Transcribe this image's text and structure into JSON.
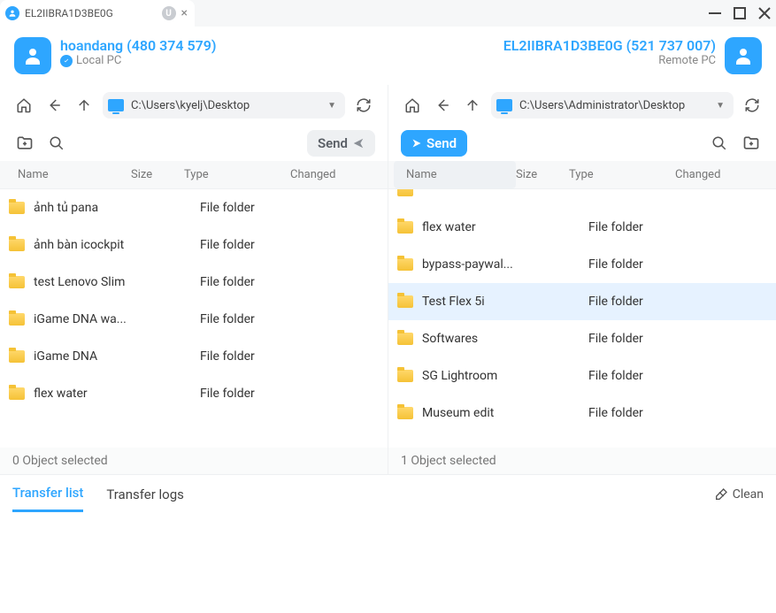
{
  "tab": {
    "title": "EL2IIBRA1D3BE0G",
    "badge": "U"
  },
  "local": {
    "name": "hoandang (480 374 579)",
    "subtitle": "Local PC",
    "path": "C:\\Users\\kyelj\\Desktop",
    "send_label": "Send",
    "status": "0 Object selected",
    "columns": {
      "name": "Name",
      "size": "Size",
      "type": "Type",
      "changed": "Changed"
    },
    "rows": [
      {
        "name": "ảnh tủ pana",
        "type": "File folder"
      },
      {
        "name": "ảnh bàn icockpit",
        "type": "File folder"
      },
      {
        "name": "test Lenovo Slim",
        "type": "File folder"
      },
      {
        "name": "iGame DNA wa...",
        "type": "File folder"
      },
      {
        "name": "iGame DNA",
        "type": "File folder"
      },
      {
        "name": "flex water",
        "type": "File folder"
      }
    ]
  },
  "remote": {
    "name": "EL2IIBRA1D3BE0G (521 737 007)",
    "subtitle": "Remote PC",
    "path": "C:\\Users\\Administrator\\Desktop",
    "send_label": "Send",
    "status": "1 Object selected",
    "columns": {
      "name": "Name",
      "size": "Size",
      "type": "Type",
      "changed": "Changed"
    },
    "rows": [
      {
        "name": "flex water",
        "type": "File folder"
      },
      {
        "name": "bypass-paywal...",
        "type": "File folder"
      },
      {
        "name": "Test Flex 5i",
        "type": "File folder",
        "selected": true
      },
      {
        "name": "Softwares",
        "type": "File folder"
      },
      {
        "name": "SG Lightroom",
        "type": "File folder"
      },
      {
        "name": "Museum edit",
        "type": "File folder"
      }
    ]
  },
  "transfer": {
    "tab_list": "Transfer list",
    "tab_logs": "Transfer logs",
    "clean": "Clean"
  }
}
